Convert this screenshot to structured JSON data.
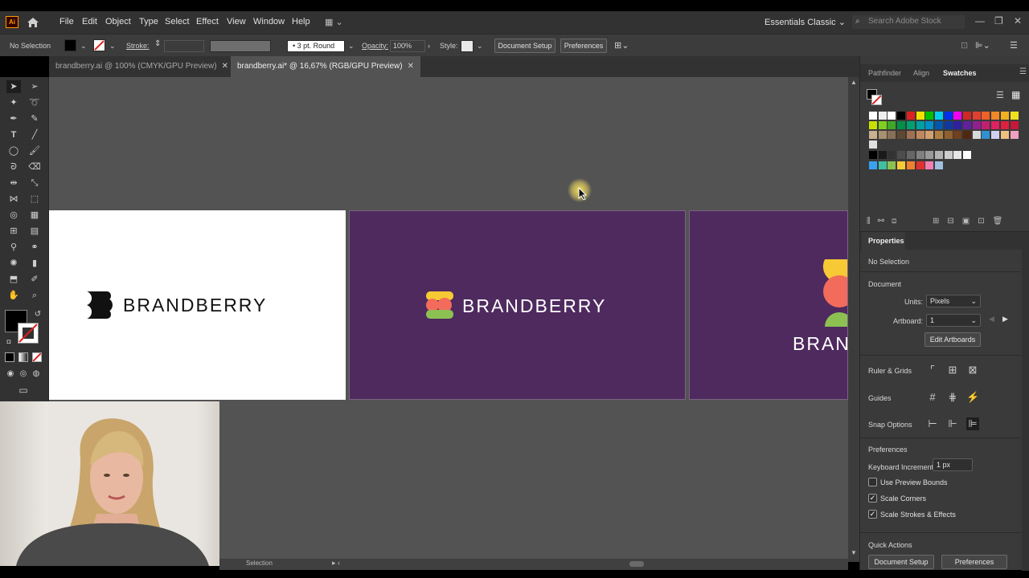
{
  "app": {
    "logo": "Ai"
  },
  "menu": [
    "File",
    "Edit",
    "Object",
    "Type",
    "Select",
    "Effect",
    "View",
    "Window",
    "Help"
  ],
  "workspace": "Essentials Classic",
  "search_placeholder": "Search Adobe Stock",
  "control": {
    "selection": "No Selection",
    "stroke_label": "Stroke:",
    "brush": "3 pt. Round",
    "opacity_label": "Opacity:",
    "opacity_value": "100%",
    "style_label": "Style:",
    "doc_setup": "Document Setup",
    "preferences": "Preferences"
  },
  "tabs": [
    {
      "label": "brandberry.ai @ 100% (CMYK/GPU Preview)",
      "active": false
    },
    {
      "label": "brandberry.ai* @ 16,67% (RGB/GPU Preview)",
      "active": true
    }
  ],
  "artboards": {
    "logo_text": "BRANDBERRY",
    "partial_text": "BRAND",
    "purple": "#4e2a5e",
    "logo_colors": {
      "yellow": "#f7c934",
      "red": "#f26b5b",
      "green": "#8cc152"
    }
  },
  "panels": {
    "tabs": [
      "Pathfinder",
      "Align",
      "Swatches"
    ],
    "active_tab": "Swatches"
  },
  "properties": {
    "title": "Properties",
    "selection": "No Selection",
    "document": "Document",
    "units_label": "Units:",
    "units_value": "Pixels",
    "artboard_label": "Artboard:",
    "artboard_value": "1",
    "edit_artboards": "Edit Artboards",
    "ruler_grids": "Ruler & Grids",
    "guides": "Guides",
    "snap_options": "Snap Options",
    "preferences": "Preferences",
    "keyboard_label": "Keyboard Increment:",
    "keyboard_value": "1 px",
    "use_preview_bounds": "Use Preview Bounds",
    "scale_corners": "Scale Corners",
    "scale_strokes": "Scale Strokes & Effects",
    "quick_actions": "Quick Actions",
    "qa_doc_setup": "Document Setup",
    "qa_preferences": "Preferences"
  },
  "status": {
    "tool": "Selection"
  }
}
